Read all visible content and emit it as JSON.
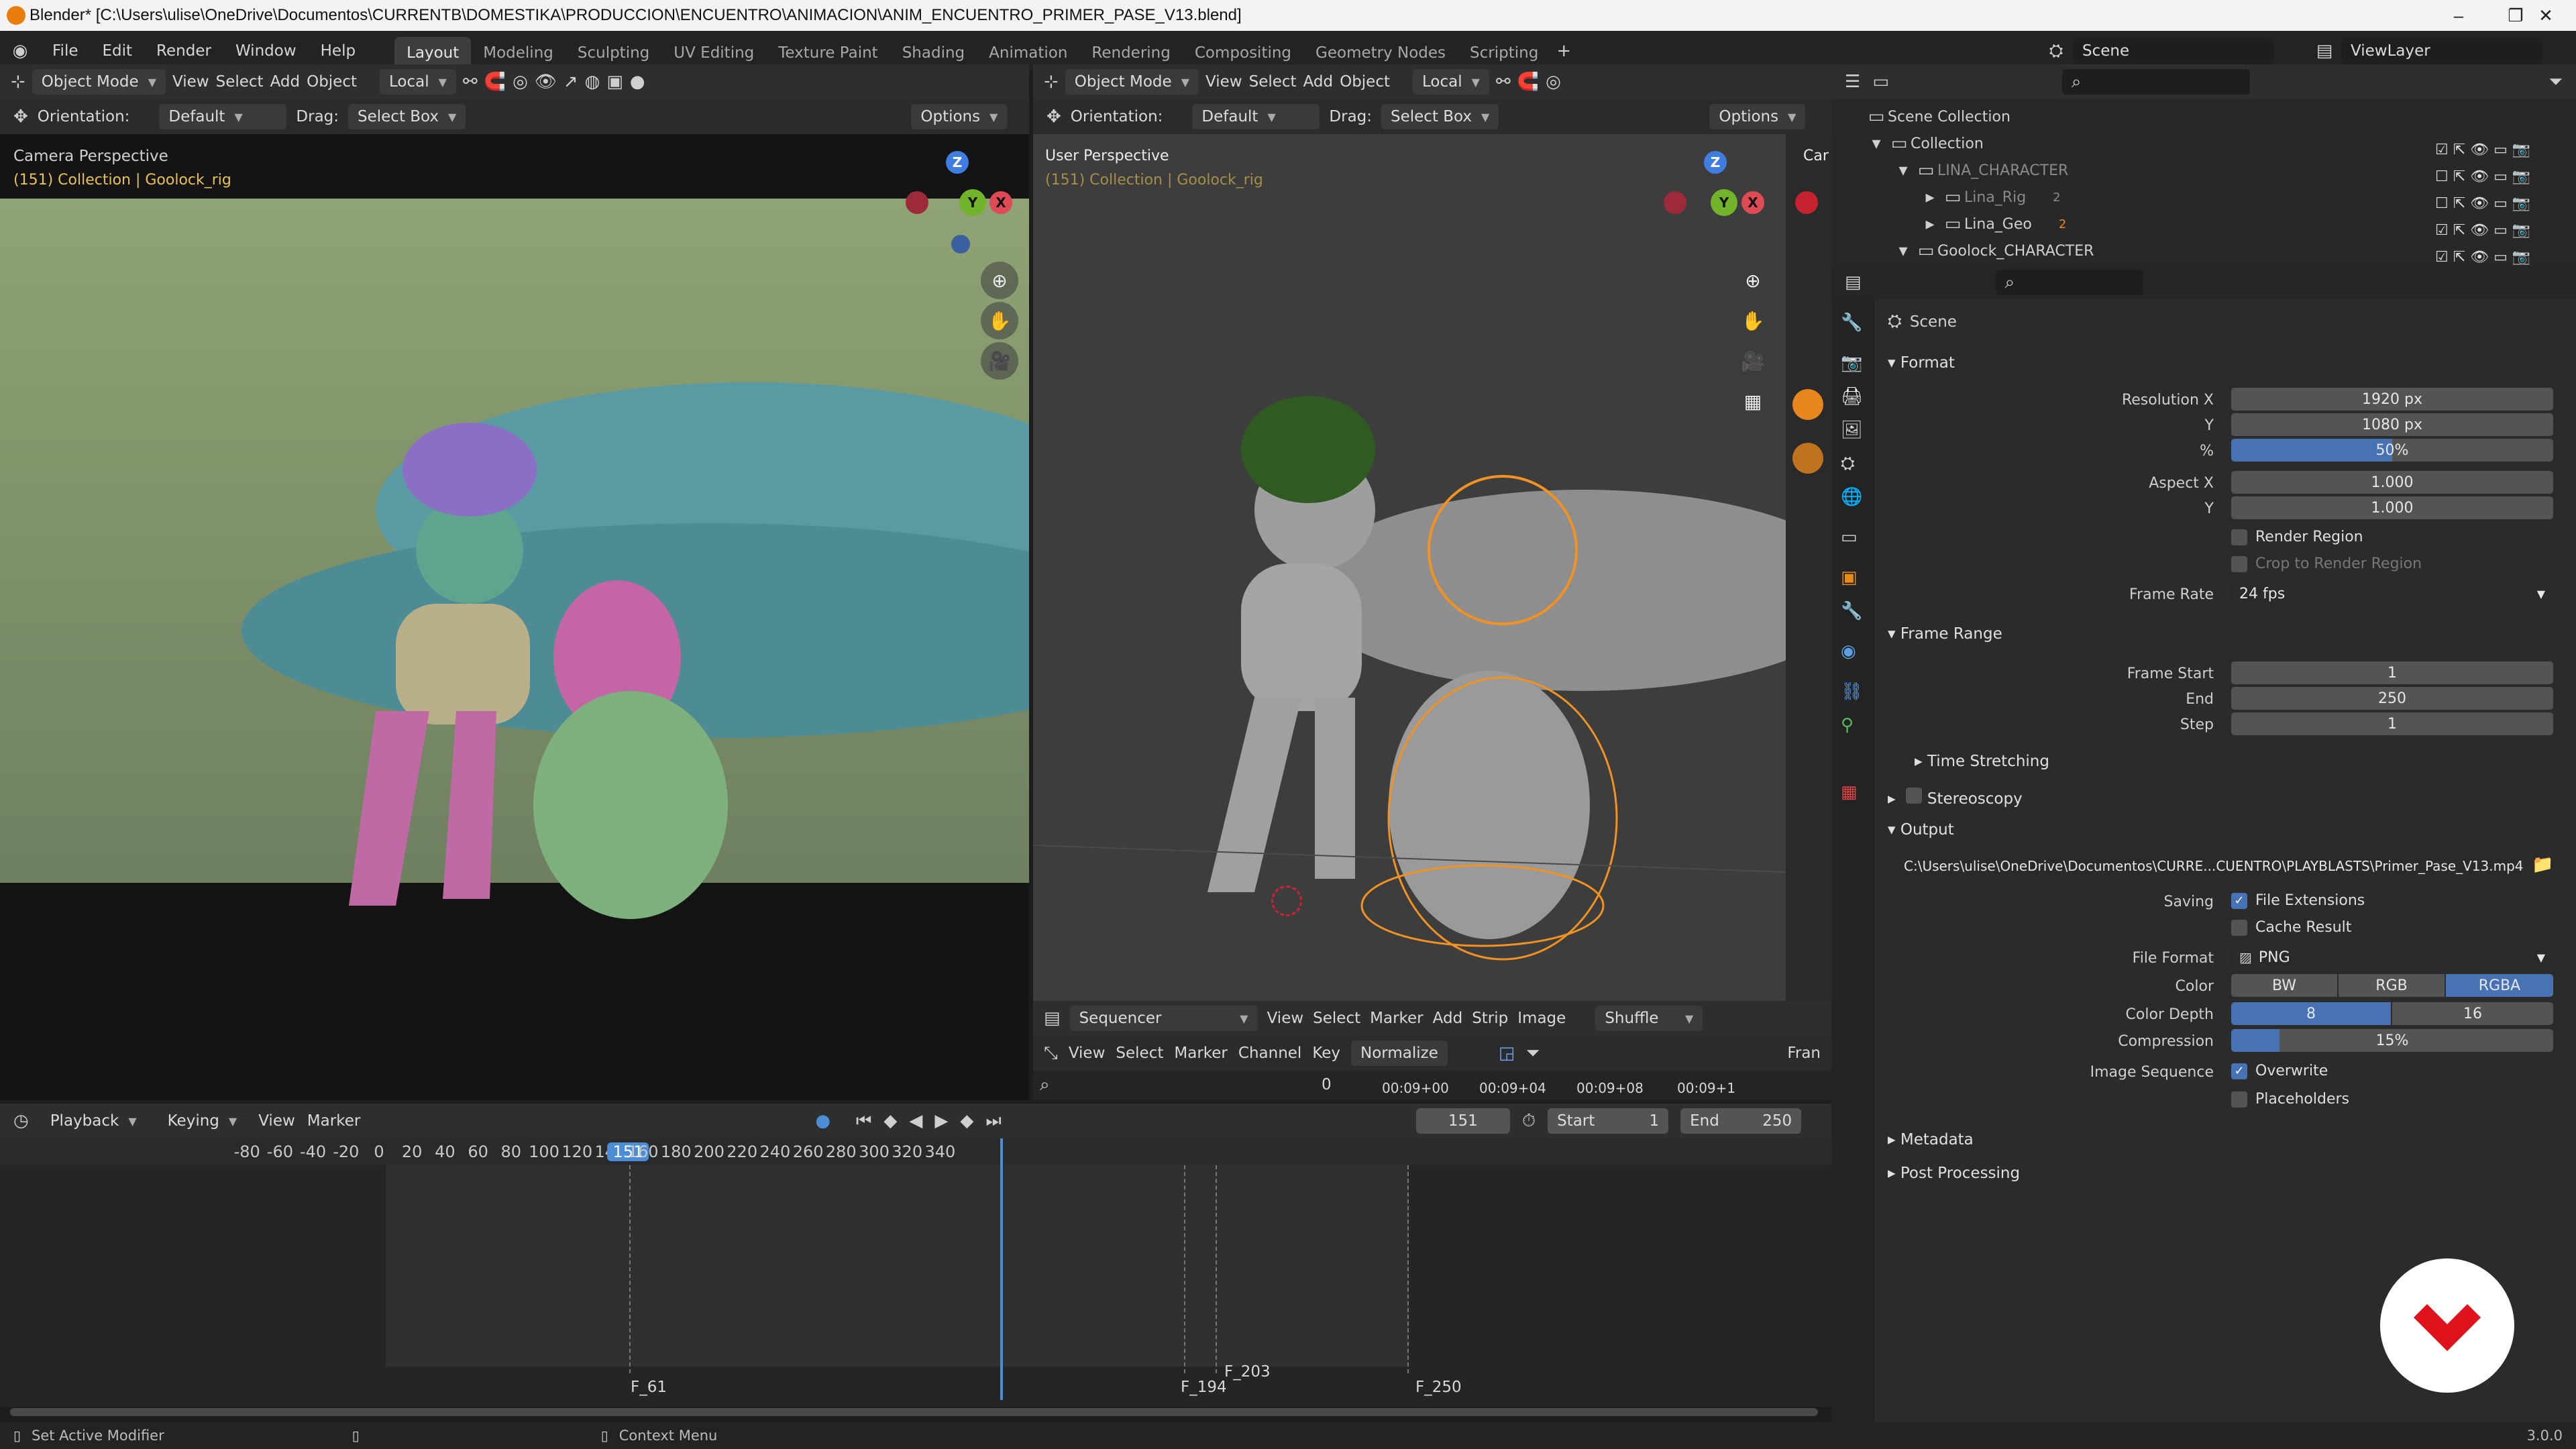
{
  "window": {
    "title": "Blender* [C:\\Users\\ulise\\OneDrive\\Documentos\\CURRENTB\\DOMESTIKA\\PRODUCCION\\ENCUENTRO\\ANIMACION\\ANIM_ENCUENTRO_PRIMER_PASE_V13.blend]"
  },
  "menu": [
    "File",
    "Edit",
    "Render",
    "Window",
    "Help"
  ],
  "workspaces": [
    "Layout",
    "Modeling",
    "Sculpting",
    "UV Editing",
    "Texture Paint",
    "Shading",
    "Animation",
    "Rendering",
    "Compositing",
    "Geometry Nodes",
    "Scripting"
  ],
  "active_workspace": "Layout",
  "scene": {
    "name": "Scene",
    "view_layer": "ViewLayer"
  },
  "left_view": {
    "mode": "Object Mode",
    "menus": [
      "View",
      "Select",
      "Add",
      "Object"
    ],
    "transform": "Local",
    "orientation_label": "Orientation:",
    "orientation": "Default",
    "drag_label": "Drag:",
    "drag": "Select Box",
    "options": "Options",
    "title": "Camera Perspective",
    "subtitle": "(151) Collection | Goolock_rig"
  },
  "right_view": {
    "mode": "Object Mode",
    "menus": [
      "View",
      "Select",
      "Add",
      "Object"
    ],
    "transform": "Local",
    "orientation_label": "Orientation:",
    "orientation": "Default",
    "drag_label": "Drag:",
    "drag": "Select Box",
    "options": "Options",
    "title": "User Perspective",
    "subtitle": "(151) Collection | Goolock_rig",
    "clipped_label": "Car"
  },
  "sequencer": {
    "editor": "Sequencer",
    "menus": [
      "View",
      "Select",
      "Marker",
      "Add",
      "Strip",
      "Image"
    ],
    "shuffle": "Shuffle",
    "menus2": [
      "View",
      "Select",
      "Marker",
      "Channel",
      "Key"
    ],
    "normalize": "Normalize",
    "frame_clip": "Fran",
    "ruler": [
      "0",
      "00:09+00",
      "00:09+04",
      "00:09+08",
      "00:09+1"
    ]
  },
  "timeline": {
    "menus": [
      "Playback",
      "Keying",
      "View",
      "Marker"
    ],
    "current_frame": "151",
    "start_label": "Start",
    "start": "1",
    "end_label": "End",
    "end": "250",
    "ticks": [
      "-80",
      "-60",
      "-40",
      "-20",
      "0",
      "20",
      "40",
      "60",
      "80",
      "100",
      "120",
      "140",
      "151",
      "160",
      "180",
      "200",
      "220",
      "240",
      "260",
      "280",
      "300",
      "320",
      "340"
    ],
    "markers": [
      "F_61",
      "F_194",
      "F_203",
      "F_250"
    ]
  },
  "outliner": {
    "root": "Scene Collection",
    "items": [
      "Collection",
      "LINA_CHARACTER",
      "Lina_Rig",
      "Lina_Geo",
      "Goolock_CHARACTER"
    ],
    "badges": [
      "2",
      "2"
    ]
  },
  "properties": {
    "context": "Scene",
    "format": {
      "title": "Format",
      "res_x_label": "Resolution X",
      "res_x": "1920 px",
      "res_y_label": "Y",
      "res_y": "1080 px",
      "pct_label": "%",
      "pct": "50%",
      "pct_fraction": 0.5,
      "aspect_x_label": "Aspect X",
      "aspect_x": "1.000",
      "aspect_y_label": "Y",
      "aspect_y": "1.000",
      "render_region": "Render Region",
      "crop": "Crop to Render Region",
      "fps_label": "Frame Rate",
      "fps": "24 fps"
    },
    "frame_range": {
      "title": "Frame Range",
      "start_label": "Frame Start",
      "start": "1",
      "end_label": "End",
      "end": "250",
      "step_label": "Step",
      "step": "1",
      "time_stretching": "Time Stretching"
    },
    "stereoscopy": "Stereoscopy",
    "output": {
      "title": "Output",
      "path": "C:\\Users\\ulise\\OneDrive\\Documentos\\CURRE...CUENTRO\\PLAYBLASTS\\Primer_Pase_V13.mp4",
      "saving_label": "Saving",
      "file_ext": "File Extensions",
      "cache": "Cache Result",
      "format_label": "File Format",
      "format": "PNG",
      "color_label": "Color",
      "colors": [
        "BW",
        "RGB",
        "RGBA"
      ],
      "active_color": "RGBA",
      "depth_label": "Color Depth",
      "depths": [
        "8",
        "16"
      ],
      "compression_label": "Compression",
      "compression": "15%",
      "compression_fraction": 0.15,
      "seq_label": "Image Sequence",
      "overwrite": "Overwrite",
      "placeholders": "Placeholders"
    },
    "metadata": "Metadata",
    "post": "Post Processing"
  },
  "status": {
    "left": "Set Active Modifier",
    "middle": "Context Menu",
    "version": "3.0.0"
  },
  "colors": {
    "accent": "#4772b3",
    "orange": "#e88a1a",
    "playhead": "#4b8ed6",
    "brand_red": "#e0121c"
  }
}
